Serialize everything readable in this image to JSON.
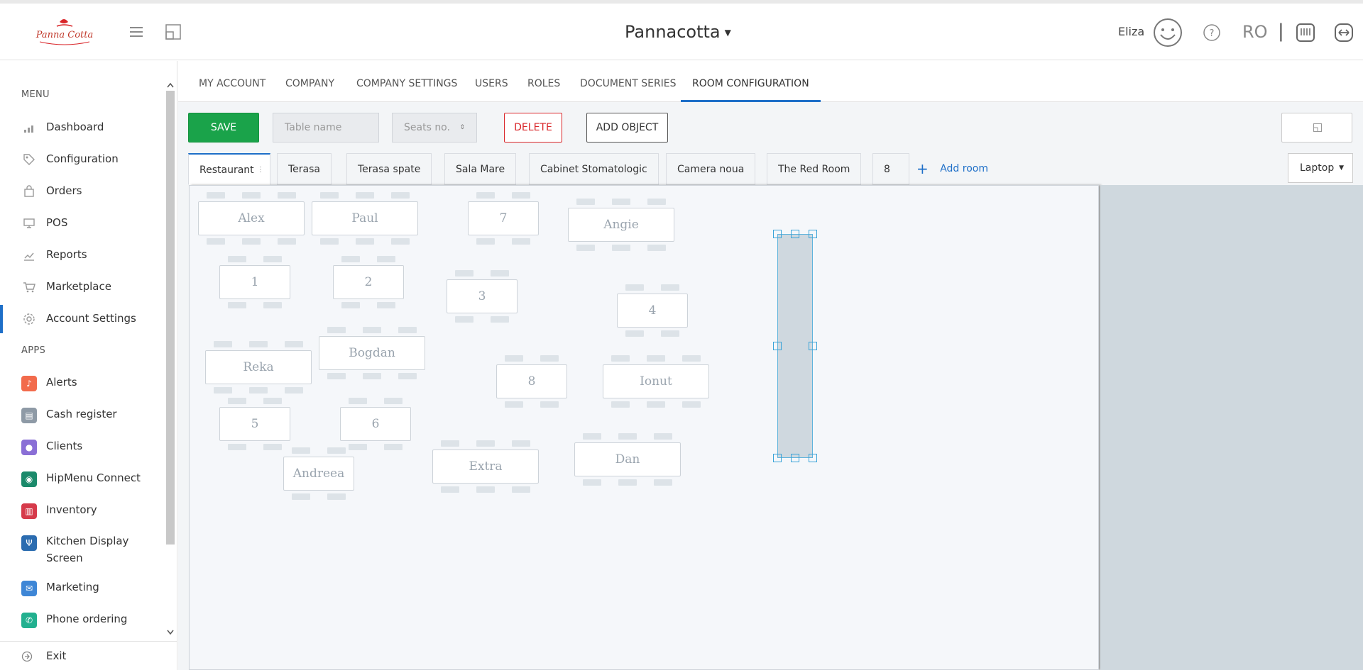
{
  "header": {
    "company": "Pannacotta",
    "user": "Eliza",
    "language": "RO",
    "separator": "|"
  },
  "sidebar": {
    "menu_label": "MENU",
    "apps_label": "APPS",
    "menu_items": [
      {
        "label": "Dashboard",
        "icon": "dashboard-icon"
      },
      {
        "label": "Configuration",
        "icon": "tag-icon"
      },
      {
        "label": "Orders",
        "icon": "bag-icon"
      },
      {
        "label": "POS",
        "icon": "monitor-icon"
      },
      {
        "label": "Reports",
        "icon": "chart-icon"
      },
      {
        "label": "Marketplace",
        "icon": "cart-icon"
      },
      {
        "label": "Account Settings",
        "icon": "gear-icon"
      }
    ],
    "app_items": [
      {
        "label": "Alerts",
        "color": "#f26b4c"
      },
      {
        "label": "Cash register",
        "color": "#8e9aa6"
      },
      {
        "label": "Clients",
        "color": "#8a6fd6"
      },
      {
        "label": "HipMenu Connect",
        "color": "#1b8a6b"
      },
      {
        "label": "Inventory",
        "color": "#d63a4a"
      },
      {
        "label": "Kitchen Display Screen",
        "color": "#2b6cb0"
      },
      {
        "label": "Marketing",
        "color": "#3e86d6"
      },
      {
        "label": "Phone ordering",
        "color": "#22b08f"
      }
    ],
    "exit": "Exit"
  },
  "tabs": [
    "MY ACCOUNT",
    "COMPANY",
    "COMPANY SETTINGS",
    "USERS",
    "ROLES",
    "DOCUMENT SERIES",
    "ROOM CONFIGURATION"
  ],
  "toolbar": {
    "save": "SAVE",
    "table_name_placeholder": "Table name",
    "seats_placeholder": "Seats no.",
    "delete": "DELETE",
    "add_object": "ADD OBJECT"
  },
  "rooms": [
    "Restaurant",
    "Terasa",
    "Terasa spate",
    "Sala Mare",
    "Cabinet Stomatologic",
    "Camera noua",
    "The Red Room",
    "8"
  ],
  "add_room": "Add room",
  "device": "Laptop",
  "tables": [
    "Alex",
    "Paul",
    "7",
    "Angie",
    "1",
    "2",
    "3",
    "4",
    "Reka",
    "Bogdan",
    "8",
    "Ionut",
    "5",
    "6",
    "Andreea",
    "Extra",
    "Dan"
  ]
}
